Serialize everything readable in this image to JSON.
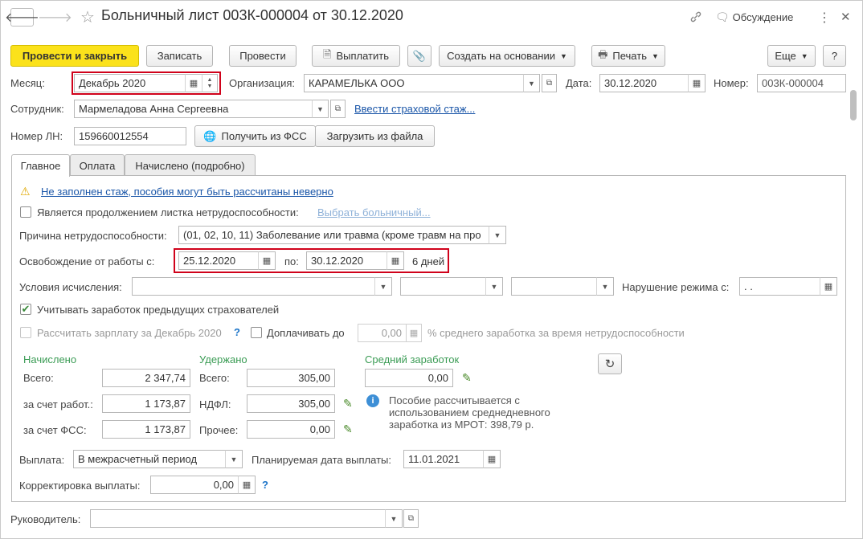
{
  "window": {
    "title": "Больничный лист 003К-000004 от 30.12.2020",
    "link_icon": "link-icon",
    "discussion_label": "Обсуждение",
    "more_icon": "⋮",
    "close_icon": "✕"
  },
  "toolbar": {
    "post_and_close": "Провести и закрыть",
    "save": "Записать",
    "post": "Провести",
    "pay": "Выплатить",
    "create_based_on": "Создать на основании",
    "print": "Печать",
    "more": "Еще",
    "help": "?"
  },
  "header": {
    "month_label": "Месяц:",
    "month_value": "Декабрь 2020",
    "org_label": "Организация:",
    "org_value": "КАРАМЕЛЬКА ООО",
    "date_label": "Дата:",
    "date_value": "30.12.2020",
    "number_label": "Номер:",
    "number_value": "003К-000004",
    "employee_label": "Сотрудник:",
    "employee_value": "Мармеладова Анна Сергеевна",
    "insurance_link": "Ввести страховой стаж...",
    "ln_label": "Номер ЛН:",
    "ln_value": "159660012554",
    "get_fss": "Получить из ФСС",
    "load_file": "Загрузить из файла"
  },
  "tabs": [
    {
      "label": "Главное"
    },
    {
      "label": "Оплата"
    },
    {
      "label": "Начислено (подробно)"
    }
  ],
  "main": {
    "warning_link": "Не заполнен стаж, пособия могут быть рассчитаны неверно",
    "continuation_label": "Является продолжением листка нетрудоспособности:",
    "choose_sick_link": "Выбрать больничный...",
    "reason_label": "Причина нетрудоспособности:",
    "reason_value": "(01, 02, 10, 11) Заболевание или травма (кроме травм на про",
    "release_label": "Освобождение от работы с:",
    "release_from": "25.12.2020",
    "release_to_label": "по:",
    "release_to": "30.12.2020",
    "release_days": "6 дней",
    "calc_conditions_label": "Условия исчисления:",
    "regime_violation_label": "Нарушение режима с:",
    "regime_violation_value": " .  .",
    "consider_earnings_label": "Учитывать заработок предыдущих страхователей",
    "calc_salary_label": "Рассчитать зарплату за Декабрь 2020",
    "calc_salary_help": "?",
    "top_up_label": "Доплачивать до",
    "top_up_value": "0,00",
    "top_up_suffix": "% среднего заработка за время нетрудоспособности"
  },
  "totals": {
    "accrued_header": "Начислено",
    "withheld_header": "Удержано",
    "avg_header": "Средний заработок",
    "total_label": "Всего:",
    "accrued_total": "2 347,74",
    "employer_label": "за счет работ.:",
    "accrued_employer": "1 173,87",
    "fss_label": "за счет ФСС:",
    "accrued_fss": "1 173,87",
    "withheld_total_label": "Всего:",
    "withheld_total": "305,00",
    "ndfl_label": "НДФЛ:",
    "withheld_ndfl": "305,00",
    "other_label": "Прочее:",
    "withheld_other": "0,00",
    "avg_value": "0,00",
    "info_text_1": "Пособие рассчитывается с",
    "info_text_2": "использованием среднедневного",
    "info_text_3": "заработка из МРОТ: 398,79 р."
  },
  "payment": {
    "payout_label": "Выплата:",
    "payout_value": "В межрасчетный период",
    "planned_date_label": "Планируемая дата выплаты:",
    "planned_date_value": "11.01.2021",
    "correction_label": "Корректировка выплаты:",
    "correction_value": "0,00",
    "correction_help": "?"
  },
  "footer": {
    "manager_label": "Руководитель:",
    "manager_value": ""
  }
}
